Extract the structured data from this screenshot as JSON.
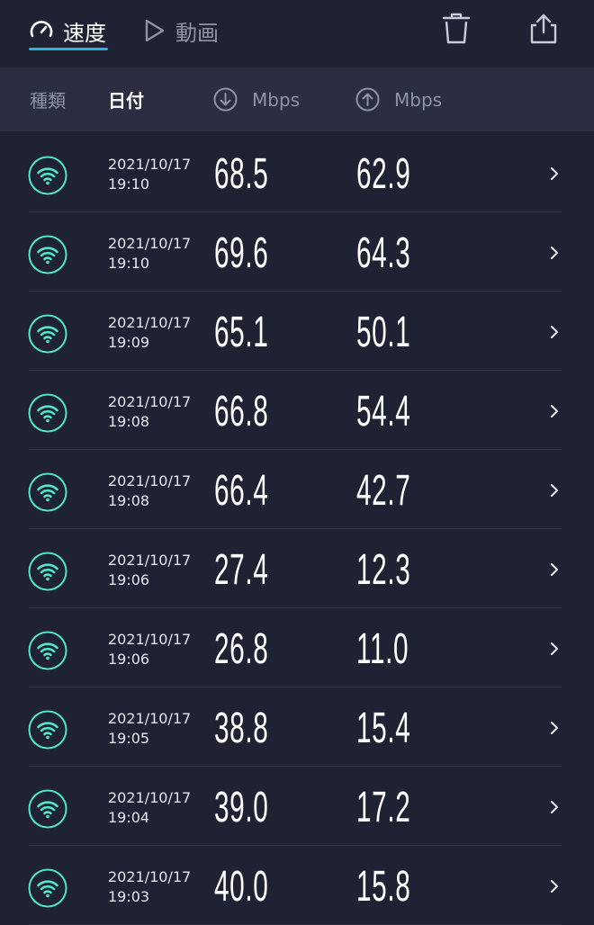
{
  "tabs": {
    "speed_label": "速度",
    "video_label": "動画"
  },
  "header": {
    "type_label": "種類",
    "date_label": "日付",
    "download_unit": "Mbps",
    "upload_unit": "Mbps"
  },
  "colors": {
    "accent": "#27b4de",
    "wifi": "#4ee6c9",
    "background": "#1f2233",
    "header_bg": "#2a2e40"
  },
  "icons": {
    "speed_tab": "speedometer-icon",
    "video_tab": "play-icon",
    "delete": "trash-icon",
    "share": "share-icon",
    "download": "arrow-down-circle-icon",
    "upload": "arrow-up-circle-icon",
    "row_type": "wifi-icon",
    "row_open": "chevron-right-icon"
  },
  "results": [
    {
      "date": "2021/10/17",
      "time": "19:10",
      "download": "68.5",
      "upload": "62.9"
    },
    {
      "date": "2021/10/17",
      "time": "19:10",
      "download": "69.6",
      "upload": "64.3"
    },
    {
      "date": "2021/10/17",
      "time": "19:09",
      "download": "65.1",
      "upload": "50.1"
    },
    {
      "date": "2021/10/17",
      "time": "19:08",
      "download": "66.8",
      "upload": "54.4"
    },
    {
      "date": "2021/10/17",
      "time": "19:08",
      "download": "66.4",
      "upload": "42.7"
    },
    {
      "date": "2021/10/17",
      "time": "19:06",
      "download": "27.4",
      "upload": "12.3"
    },
    {
      "date": "2021/10/17",
      "time": "19:06",
      "download": "26.8",
      "upload": "11.0"
    },
    {
      "date": "2021/10/17",
      "time": "19:05",
      "download": "38.8",
      "upload": "15.4"
    },
    {
      "date": "2021/10/17",
      "time": "19:04",
      "download": "39.0",
      "upload": "17.2"
    },
    {
      "date": "2021/10/17",
      "time": "19:03",
      "download": "40.0",
      "upload": "15.8"
    }
  ]
}
